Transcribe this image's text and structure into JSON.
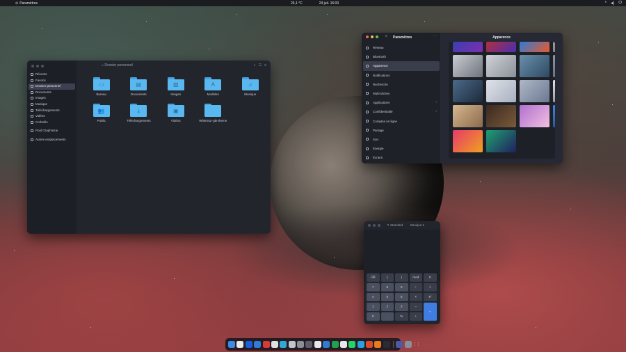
{
  "topbar": {
    "app_name": "Paramètres",
    "weather": "26,1 °C",
    "datetime": "24 juil. 16:03"
  },
  "file_manager": {
    "title": "Dossier personnel",
    "sidebar": [
      {
        "label": "Récents",
        "icon": "clock-icon"
      },
      {
        "label": "Favoris",
        "icon": "star-icon"
      },
      {
        "label": "Dossier personnel",
        "icon": "home-icon",
        "active": true
      },
      {
        "label": "Documents",
        "icon": "document-icon"
      },
      {
        "label": "Images",
        "icon": "image-icon"
      },
      {
        "label": "Musique",
        "icon": "music-icon"
      },
      {
        "label": "Téléchargements",
        "icon": "download-icon"
      },
      {
        "label": "Vidéos",
        "icon": "video-icon"
      },
      {
        "label": "Corbeille",
        "icon": "trash-icon"
      },
      {
        "label": "Pool Graphisme",
        "icon": "drive-icon",
        "gap": true
      },
      {
        "label": "Autres emplacements",
        "icon": "plus-icon",
        "gap": true
      }
    ],
    "folders": [
      {
        "label": "Bureau",
        "glyph": "▭"
      },
      {
        "label": "Documents",
        "glyph": "▤"
      },
      {
        "label": "Images",
        "glyph": "▨"
      },
      {
        "label": "Modèles",
        "glyph": "A"
      },
      {
        "label": "Musique",
        "glyph": "♫"
      },
      {
        "label": "Public",
        "glyph": "👥"
      },
      {
        "label": "Téléchargements",
        "glyph": "⤓"
      },
      {
        "label": "Vidéos",
        "glyph": "▣"
      },
      {
        "label": "WhiteSur-gtk-theme",
        "glyph": ""
      }
    ]
  },
  "settings": {
    "sidebar_title": "Paramètres",
    "panel_title": "Apparence",
    "items": [
      {
        "label": "Réseau",
        "icon": "network-icon"
      },
      {
        "label": "Bluetooth",
        "icon": "bluetooth-icon"
      },
      {
        "label": "Apparence",
        "icon": "appearance-icon",
        "active": true
      },
      {
        "label": "Notifications",
        "icon": "bell-icon"
      },
      {
        "label": "Recherche",
        "icon": "search-icon"
      },
      {
        "label": "Multi-tâches",
        "icon": "multitask-icon"
      },
      {
        "label": "Applications",
        "icon": "apps-icon",
        "chevron": true
      },
      {
        "label": "Confidentialité",
        "icon": "hand-icon",
        "chevron": true
      },
      {
        "label": "Comptes en ligne",
        "icon": "cloud-icon"
      },
      {
        "label": "Partage",
        "icon": "share-icon"
      },
      {
        "label": "Son",
        "icon": "speaker-icon"
      },
      {
        "label": "Énergie",
        "icon": "power-icon"
      },
      {
        "label": "Écrans",
        "icon": "display-icon"
      }
    ],
    "wallpapers": [
      {
        "c1": "#3b3fb0",
        "c2": "#7b2fb0",
        "short": true
      },
      {
        "c1": "#b02f3f",
        "c2": "#4a2fb0",
        "short": true
      },
      {
        "c1": "#2f7bd8",
        "c2": "#e85a2a",
        "short": true
      },
      {
        "c1": "#9a9aa2",
        "c2": "#5a5a62",
        "short": true
      },
      {
        "c1": "#c8ccd2",
        "c2": "#6f747d"
      },
      {
        "c1": "#cfd3d8",
        "c2": "#8a9099"
      },
      {
        "c1": "#6a8faa",
        "c2": "#2e4a62"
      },
      {
        "c1": "#8a9aaa",
        "c2": "#3a4a5a"
      },
      {
        "c1": "#4a6a8a",
        "c2": "#1e2a3a"
      },
      {
        "c1": "#dfe2e8",
        "c2": "#a8b0c0"
      },
      {
        "c1": "#b0b8c8",
        "c2": "#6a7890"
      },
      {
        "c1": "#e8e8ea",
        "c2": "#3a3a40"
      },
      {
        "c1": "#d8b890",
        "c2": "#8a6a4a"
      },
      {
        "c1": "#3a2a20",
        "c2": "#7a5a3a"
      },
      {
        "c1": "#b070d0",
        "c2": "#f0c0e0"
      },
      {
        "c1": "#3a8ae8",
        "c2": "#1a1a30"
      },
      {
        "c1": "#e83a6a",
        "c2": "#f0a020"
      },
      {
        "c1": "#20a070",
        "c2": "#202060"
      }
    ]
  },
  "calculator": {
    "mode_label": "Standard",
    "mode_select": "Basique",
    "keys": [
      "⌫",
      "(",
      ")",
      "mod",
      "π",
      "7",
      "8",
      "9",
      "÷",
      "√",
      "4",
      "5",
      "6",
      "×",
      "x²",
      "1",
      "2",
      "3",
      "−",
      "=",
      "0",
      ",",
      "%",
      "+"
    ]
  },
  "dock": {
    "apps": [
      {
        "name": "finder-icon",
        "color": "#3a8ae8",
        "glyph": ""
      },
      {
        "name": "calendar-icon",
        "color": "#e8e8ea",
        "glyph": ""
      },
      {
        "name": "bitwarden-icon",
        "color": "#175ddc",
        "glyph": ""
      },
      {
        "name": "app-store-icon",
        "color": "#2f7bd8",
        "glyph": ""
      },
      {
        "name": "pdf-icon",
        "color": "#d83a3a",
        "glyph": ""
      },
      {
        "name": "chrome-icon",
        "color": "#e0e0e0",
        "glyph": ""
      },
      {
        "name": "photos-icon",
        "color": "#2fa8d8",
        "glyph": ""
      },
      {
        "name": "monitor-icon",
        "color": "#c0c4cc",
        "glyph": ""
      },
      {
        "name": "settings-gear-icon",
        "color": "#8a8e96",
        "glyph": ""
      },
      {
        "name": "font-viewer-icon",
        "color": "#5a5e6a",
        "glyph": ""
      },
      {
        "name": "text-editor-icon",
        "color": "#e8e8ea",
        "glyph": ""
      },
      {
        "name": "code-icon",
        "color": "#2f7bd8",
        "glyph": ""
      },
      {
        "name": "spreadsheet-icon",
        "color": "#20a050",
        "glyph": ""
      },
      {
        "name": "music-player-icon",
        "color": "#e8e8ea",
        "glyph": ""
      },
      {
        "name": "whatsapp-icon",
        "color": "#25d366",
        "glyph": ""
      },
      {
        "name": "telegram-icon",
        "color": "#2aa0e0",
        "glyph": ""
      },
      {
        "name": "store-icon",
        "color": "#d84a2a",
        "glyph": ""
      },
      {
        "name": "blender-icon",
        "color": "#e87a20",
        "glyph": ""
      },
      {
        "name": "terminal-icon",
        "color": "#2a2c34",
        "glyph": ""
      },
      {
        "name": "screenshot-icon",
        "color": "#4a5aa8",
        "glyph": ""
      },
      {
        "name": "trash-icon",
        "color": "#8a8e96",
        "glyph": ""
      },
      {
        "name": "app-grid-icon",
        "color": "transparent",
        "glyph": "⋮⋮"
      }
    ]
  }
}
